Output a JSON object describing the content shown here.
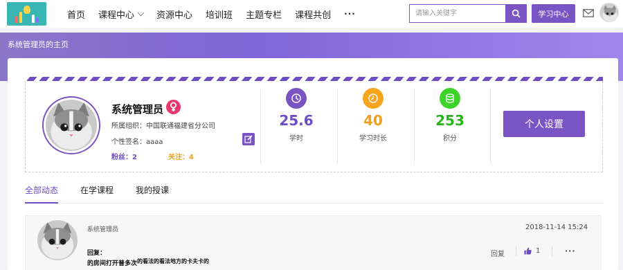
{
  "nav": {
    "items": [
      {
        "label": "首页"
      },
      {
        "label": "课程中心"
      },
      {
        "label": "资源中心"
      },
      {
        "label": "培训班"
      },
      {
        "label": "主题专栏"
      },
      {
        "label": "课程共创"
      }
    ],
    "more": "···"
  },
  "search": {
    "placeholder": "请输入关键字"
  },
  "header": {
    "study_center": "学习中心"
  },
  "banner": {
    "title": "系统管理员的主页"
  },
  "profile": {
    "name": "系统管理员",
    "org_label": "所属组织：",
    "org_value": "中国联通福建省分公司",
    "sign_label": "个性签名：",
    "sign_value": "aaaa",
    "fans_label": "粉丝：",
    "fans_count": "2",
    "follow_label": "关注：",
    "follow_count": "4",
    "settings_button": "个人设置"
  },
  "stats": [
    {
      "value": "25.6",
      "label": "学时",
      "color": "#7b54c4",
      "icon": "credit-hour-icon"
    },
    {
      "value": "40",
      "label": "学习时长",
      "color": "#f7a51c",
      "icon": "clock-icon"
    },
    {
      "value": "253",
      "label": "积分",
      "color": "#3cd42a",
      "icon": "coins-icon"
    }
  ],
  "tabs": [
    {
      "label": "全部动态"
    },
    {
      "label": "在学课程"
    },
    {
      "label": "我的授课"
    }
  ],
  "feed": {
    "user": "系统管理员",
    "time": "2018-11-14 15:24",
    "reply_label": "回复：",
    "content_main": "的房间打开普多次",
    "content_sub": "的看法的看法地方的卡夫卡的",
    "reply_action": "回复",
    "like_count": "1",
    "more": "···"
  },
  "colors": {
    "accent": "#7b54c4",
    "female": "#e8366f"
  }
}
